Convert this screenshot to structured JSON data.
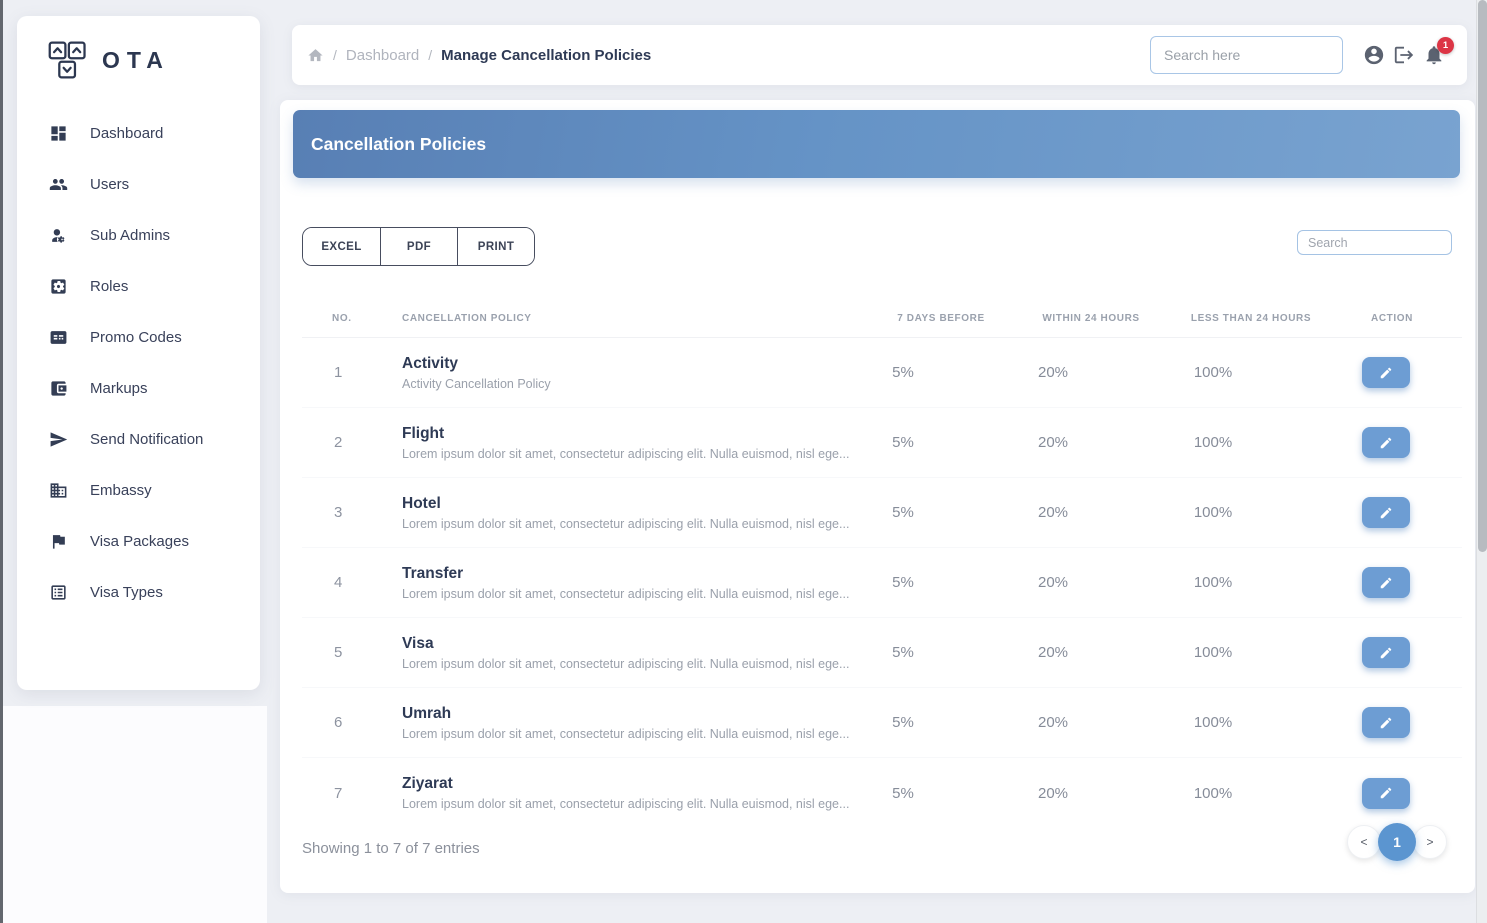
{
  "colors": {
    "banner_blue": "#5f8ec3",
    "accent_blue": "#6d9dd3",
    "active_page_blue": "#5b95d0",
    "badge_red": "#dc3545",
    "navy_text": "#2e3a55"
  },
  "app": {
    "logo_text": "OTA",
    "logo_icon": "keyboard-keys-icon"
  },
  "sidebar": {
    "items": [
      {
        "label": "Dashboard",
        "icon": "dashboard-icon"
      },
      {
        "label": "Users",
        "icon": "users-icon"
      },
      {
        "label": "Sub Admins",
        "icon": "sub-admins-icon"
      },
      {
        "label": "Roles",
        "icon": "roles-icon"
      },
      {
        "label": "Promo Codes",
        "icon": "promo-codes-icon"
      },
      {
        "label": "Markups",
        "icon": "markups-icon"
      },
      {
        "label": "Send Notification",
        "icon": "send-notification-icon"
      },
      {
        "label": "Embassy",
        "icon": "embassy-icon"
      },
      {
        "label": "Visa Packages",
        "icon": "visa-packages-icon"
      },
      {
        "label": "Visa Types",
        "icon": "visa-types-icon"
      }
    ]
  },
  "header": {
    "breadcrumb": {
      "home_icon": "home-icon",
      "separator": "/",
      "root": "Dashboard",
      "current": "Manage Cancellation Policies"
    },
    "search_placeholder": "Search here",
    "account_icon": "user-circle-icon",
    "logout_icon": "logout-icon",
    "bell_icon": "bell-icon",
    "notification_count": "1"
  },
  "content": {
    "banner_title": "Cancellation Policies",
    "export_buttons": [
      "EXCEL",
      "PDF",
      "PRINT"
    ],
    "table_search_placeholder": "Search",
    "table": {
      "columns": [
        "NO.",
        "CANCELLATION POLICY",
        "7 DAYS BEFORE",
        "WITHIN 24 HOURS",
        "LESS THAN 24 HOURS",
        "ACTION"
      ],
      "edit_icon": "edit-icon",
      "rows": [
        {
          "no": "1",
          "name": "Activity",
          "description": "Activity Cancellation Policy",
          "seven_days_before": "5%",
          "within_24_hours": "20%",
          "less_than_24_hours": "100%"
        },
        {
          "no": "2",
          "name": "Flight",
          "description": "Lorem ipsum dolor sit amet, consectetur adipiscing elit. Nulla euismod, nisl ege...",
          "seven_days_before": "5%",
          "within_24_hours": "20%",
          "less_than_24_hours": "100%"
        },
        {
          "no": "3",
          "name": "Hotel",
          "description": "Lorem ipsum dolor sit amet, consectetur adipiscing elit. Nulla euismod, nisl ege...",
          "seven_days_before": "5%",
          "within_24_hours": "20%",
          "less_than_24_hours": "100%"
        },
        {
          "no": "4",
          "name": "Transfer",
          "description": "Lorem ipsum dolor sit amet, consectetur adipiscing elit. Nulla euismod, nisl ege...",
          "seven_days_before": "5%",
          "within_24_hours": "20%",
          "less_than_24_hours": "100%"
        },
        {
          "no": "5",
          "name": "Visa",
          "description": "Lorem ipsum dolor sit amet, consectetur adipiscing elit. Nulla euismod, nisl ege...",
          "seven_days_before": "5%",
          "within_24_hours": "20%",
          "less_than_24_hours": "100%"
        },
        {
          "no": "6",
          "name": "Umrah",
          "description": "Lorem ipsum dolor sit amet, consectetur adipiscing elit. Nulla euismod, nisl ege...",
          "seven_days_before": "5%",
          "within_24_hours": "20%",
          "less_than_24_hours": "100%"
        },
        {
          "no": "7",
          "name": "Ziyarat",
          "description": "Lorem ipsum dolor sit amet, consectetur adipiscing elit. Nulla euismod, nisl ege...",
          "seven_days_before": "5%",
          "within_24_hours": "20%",
          "less_than_24_hours": "100%"
        }
      ]
    },
    "footer": {
      "showing_text": "Showing 1 to 7 of 7 entries",
      "pagination": {
        "prev": "<",
        "page": "1",
        "next": ">"
      }
    }
  }
}
